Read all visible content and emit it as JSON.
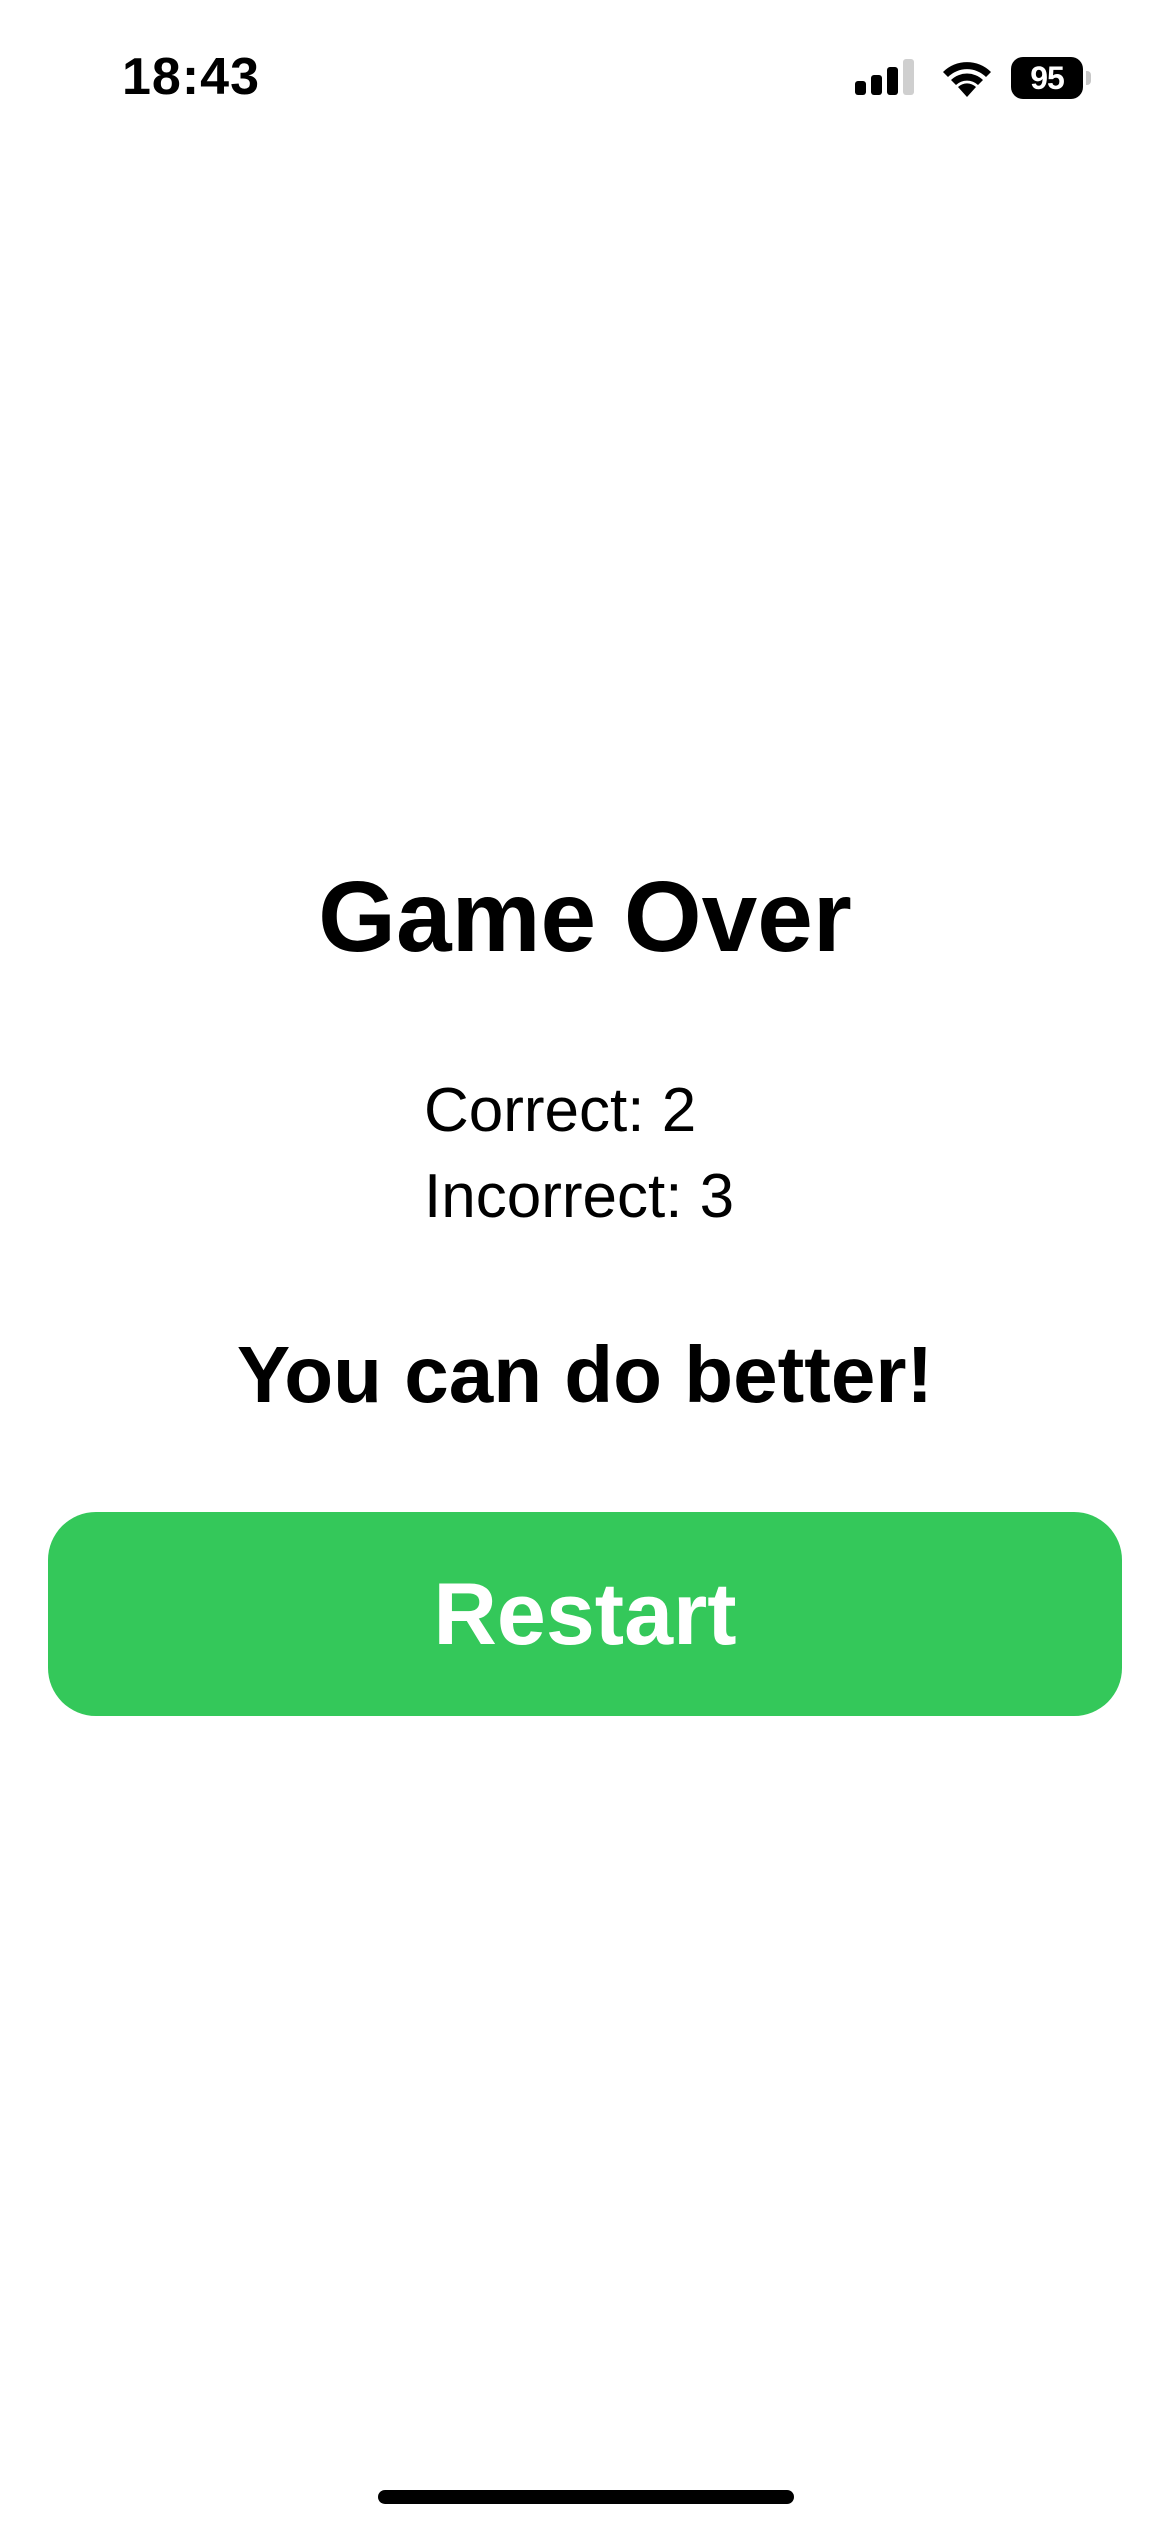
{
  "status_bar": {
    "time": "18:43",
    "battery_level": "95"
  },
  "game_over": {
    "title": "Game Over",
    "correct_label": "Correct: 2",
    "incorrect_label": "Incorrect: 3",
    "message": "You can do better!",
    "restart_label": "Restart"
  },
  "colors": {
    "restart_button": "#34c85a",
    "text": "#000000",
    "background": "#ffffff"
  },
  "icons": [
    "cellular-signal-icon",
    "wifi-icon",
    "battery-icon"
  ]
}
